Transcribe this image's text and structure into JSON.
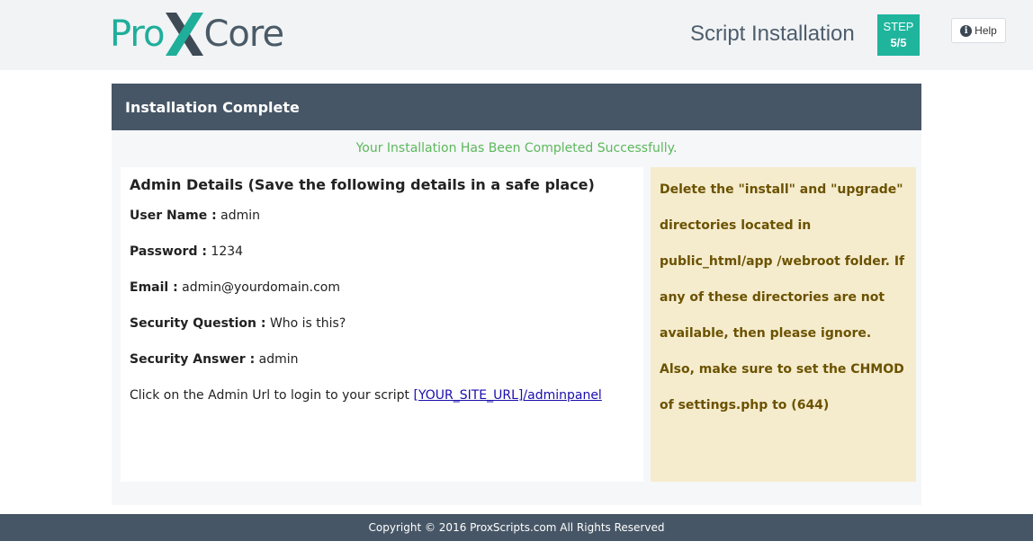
{
  "header": {
    "logo_pro": "Pro",
    "logo_core": "Core",
    "title": "Script Installation",
    "step_label": "STEP",
    "step_value": "5/5",
    "help_label": "Help"
  },
  "panel": {
    "heading": "Installation Complete",
    "success_message": "Your Installation Has Been Completed Successfully."
  },
  "admin": {
    "heading": "Admin Details (Save the following details in a safe place)",
    "fields": [
      {
        "label": "User Name :",
        "value": "admin"
      },
      {
        "label": "Password :",
        "value": "1234"
      },
      {
        "label": "Email :",
        "value": "admin@yourdomain.com"
      },
      {
        "label": "Security Question :",
        "value": "Who is this?"
      },
      {
        "label": "Security Answer :",
        "value": "admin"
      }
    ],
    "login_text": "Click on the Admin Url to login to your script",
    "login_link": "[YOUR_SITE_URL]/adminpanel"
  },
  "notice": {
    "text": "Delete the \"install\" and \"upgrade\" directories located in public_html/app /webroot folder. If any of these directories are not available, then please ignore. Also, make sure to set the CHMOD of settings.php to (644)"
  },
  "footer": {
    "copyright": "Copyright © 2016 ProxScripts.com All Rights Reserved"
  },
  "colors": {
    "accent": "#1fb59d",
    "header_bar": "#475666",
    "success": "#5cb85c",
    "notice_bg": "#f5ecce",
    "notice_text": "#6b5200"
  },
  "icons": {
    "logo_mark": "x-logo-icon",
    "help": "info-icon"
  }
}
